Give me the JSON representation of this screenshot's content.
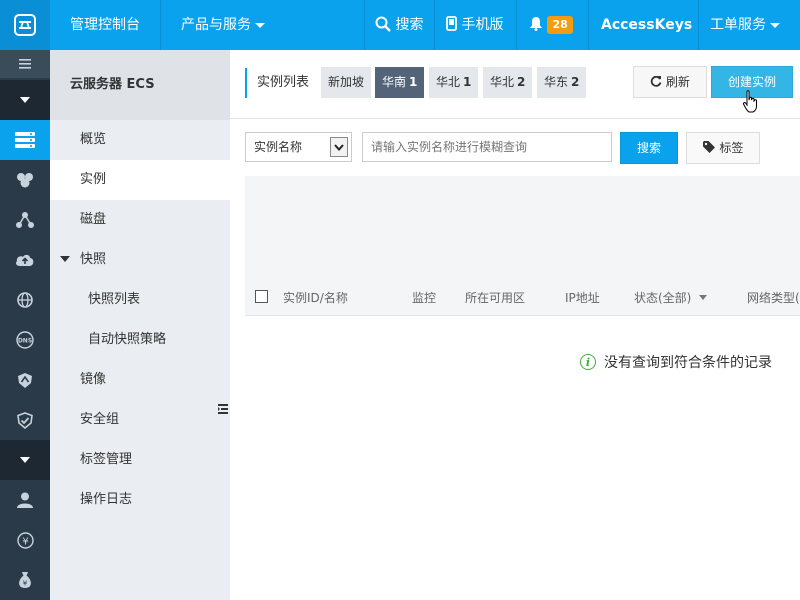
{
  "topbar": {
    "console_label": "管理控制台",
    "products_label": "产品与服务",
    "search_label": "搜索",
    "mobile_label": "手机版",
    "notification_count": "28",
    "accesskeys_label": "AccessKeys",
    "ticket_label": "工单服务",
    "colors": {
      "bar": "#0aa1ed",
      "badge": "#f39c12"
    }
  },
  "rail": {
    "icons": [
      "menu-icon",
      "chevron-down-icon",
      "server-icon",
      "cluster-icon",
      "network-icon",
      "cloud-upload-icon",
      "globe-icon",
      "dns-icon",
      "shield-icon",
      "shield-check-icon",
      "chevron-down-icon",
      "user-icon",
      "yen-icon",
      "bag-icon"
    ]
  },
  "sidebar": {
    "title": "云服务器 ECS",
    "items": [
      {
        "label": "概览"
      },
      {
        "label": "实例"
      },
      {
        "label": "磁盘"
      },
      {
        "label": "快照"
      },
      {
        "label": "快照列表"
      },
      {
        "label": "自动快照策略"
      },
      {
        "label": "镜像"
      },
      {
        "label": "安全组"
      },
      {
        "label": "标签管理"
      },
      {
        "label": "操作日志"
      }
    ]
  },
  "main": {
    "header": "实例列表",
    "regions": [
      {
        "name": "新加坡",
        "count": ""
      },
      {
        "name": "华南",
        "count": "1"
      },
      {
        "name": "华北",
        "count": "1"
      },
      {
        "name": "华北",
        "count": "2"
      },
      {
        "name": "华东",
        "count": "2"
      }
    ],
    "refresh_label": "刷新",
    "create_label": "创建实例",
    "filter_select": "实例名称",
    "search_placeholder": "请输入实例名称进行模糊查询",
    "search_button": "搜索",
    "tags_button": "标签",
    "columns": [
      "实例ID/名称",
      "监控",
      "所在可用区",
      "IP地址",
      "状态(全部)",
      "网络类型("
    ],
    "empty_message": "没有查询到符合条件的记录"
  }
}
